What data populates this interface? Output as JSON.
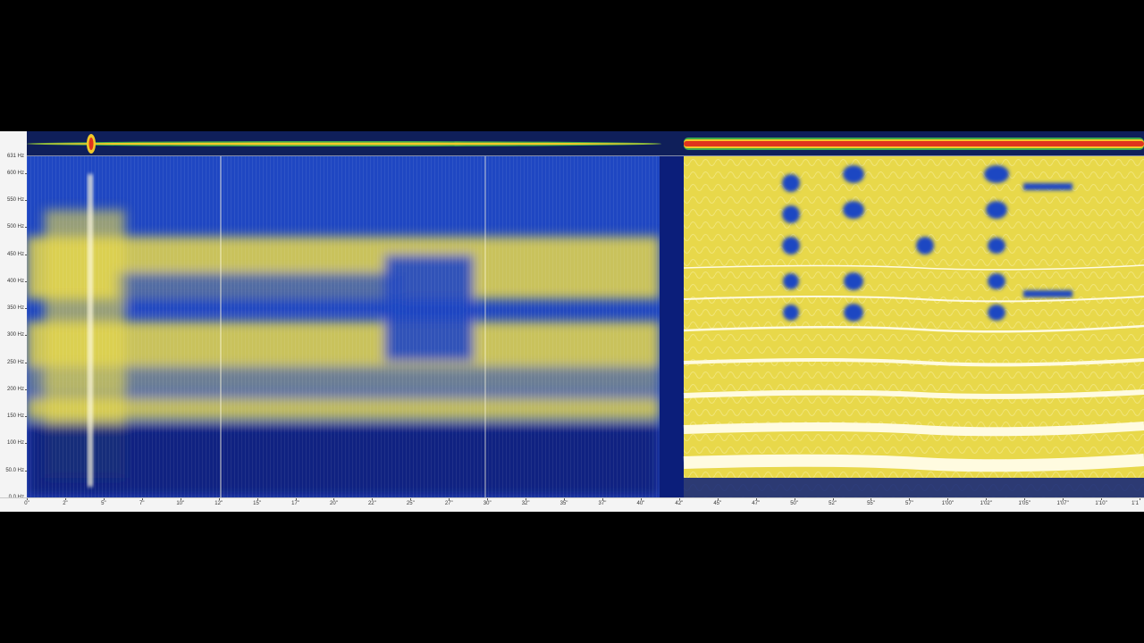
{
  "viewer": {
    "frequency_axis": {
      "top_label": "631 Hz",
      "labels": [
        "600 Hz",
        "550 Hz",
        "500 Hz",
        "450 Hz",
        "400 Hz",
        "350 Hz",
        "300 Hz",
        "250 Hz",
        "200 Hz",
        "150 Hz",
        "100 Hz",
        "50.0 Hz",
        "0.0 Hz"
      ],
      "max_hz": 631
    },
    "time_axis": {
      "labels": [
        "0\"",
        "2\"",
        "5\"",
        "7\"",
        "10\"",
        "12\"",
        "15\"",
        "17\"",
        "20\"",
        "22\"",
        "25\"",
        "27\"",
        "30\"",
        "32\"",
        "35\"",
        "37\"",
        "40\"",
        "42\"",
        "45\"",
        "47\"",
        "50\"",
        "52\"",
        "55\"",
        "57\"",
        "1'00\"",
        "1'02\"",
        "1'05\"",
        "1'07\"",
        "1'10\"",
        "1'1"
      ]
    },
    "colors": {
      "background": "#0b1e7a",
      "low": "#1f47c2",
      "mid": "#e8d84a",
      "high": "#fffbe0",
      "overview_hot": "#e0341c",
      "overview_warm": "#f3c928",
      "overview_cool": "#3fa84b"
    }
  }
}
